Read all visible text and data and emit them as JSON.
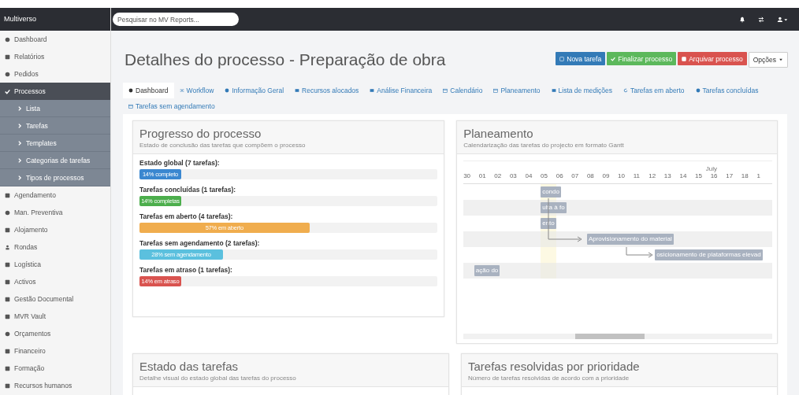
{
  "app": {
    "name": "Multiverso"
  },
  "search": {
    "placeholder": "Pesquisar no MV Reports..."
  },
  "sidebar": {
    "items": [
      {
        "label": "Dashboard",
        "selected": false
      },
      {
        "label": "Relatórios",
        "selected": false
      },
      {
        "label": "Pedidos",
        "selected": false
      },
      {
        "label": "Processos",
        "selected": true,
        "expanded": true,
        "children": [
          {
            "label": "Lista"
          },
          {
            "label": "Tarefas"
          },
          {
            "label": "Templates"
          },
          {
            "label": "Categorias de tarefas"
          },
          {
            "label": "Tipos de processos"
          }
        ]
      },
      {
        "label": "Agendamento",
        "selected": false
      },
      {
        "label": "Man. Preventiva",
        "selected": false
      },
      {
        "label": "Alojamento",
        "selected": false
      },
      {
        "label": "Rondas",
        "selected": false
      },
      {
        "label": "Logística",
        "selected": false
      },
      {
        "label": "Activos",
        "selected": false
      },
      {
        "label": "Gestão Documental",
        "selected": false
      },
      {
        "label": "MVR Vault",
        "selected": false
      },
      {
        "label": "Orçamentos",
        "selected": false
      },
      {
        "label": "Financeiro",
        "selected": false
      },
      {
        "label": "Formação",
        "selected": false
      },
      {
        "label": "Recursos humanos",
        "selected": false
      }
    ]
  },
  "page": {
    "title": "Detalhes do processo - Preparação de obra"
  },
  "actions": [
    {
      "label": "Nova tarefa",
      "kind": "primary"
    },
    {
      "label": "Finalizar processo",
      "kind": "success"
    },
    {
      "label": "Arquivar processo",
      "kind": "danger"
    },
    {
      "label": "Opções",
      "kind": "dropdown"
    }
  ],
  "tabs": [
    {
      "label": "Dashboard",
      "selected": true
    },
    {
      "label": "Workflow",
      "selected": false
    },
    {
      "label": "Informação Geral",
      "selected": false
    },
    {
      "label": "Recursos alocados",
      "selected": false
    },
    {
      "label": "Análise Financeira",
      "selected": false
    },
    {
      "label": "Calendário",
      "selected": false
    },
    {
      "label": "Planeamento",
      "selected": false
    },
    {
      "label": "Lista de medições",
      "selected": false
    },
    {
      "label": "Tarefas em aberto",
      "selected": false
    },
    {
      "label": "Tarefas concluídas",
      "selected": false
    },
    {
      "label": "Tarefas sem agendamento",
      "selected": false
    }
  ],
  "progress": {
    "title": "Progresso do processo",
    "subtitle": "Estado de conclusão das tarefas que compõem o processo",
    "bars": [
      {
        "heading": "Estado global (7 tarefas):",
        "label": "14% completo",
        "level": 0.14,
        "color": "#3a87d0"
      },
      {
        "heading": "Tarefas concluídas (1 tarefas):",
        "label": "14% completas",
        "level": 0.14,
        "color": "#4cae4c"
      },
      {
        "heading": "Tarefas em aberto (4 tarefas):",
        "label": "57% em aberto",
        "level": 0.57,
        "color": "#f0ad4e"
      },
      {
        "heading": "Tarefas sem agendamento (2 tarefas):",
        "label": "28% sem agendamento",
        "level": 0.28,
        "color": "#5bc0de"
      },
      {
        "heading": "Tarefas em atraso (1 tarefas):",
        "label": "14% em atraso",
        "level": 0.14,
        "color": "#d9534f"
      }
    ]
  },
  "planning": {
    "title": "Planeamento",
    "subtitle": "Calendarização das tarefas do projecto em formato Gantt",
    "month": "July",
    "days": [
      "30",
      "01",
      "02",
      "03",
      "04",
      "05",
      "06",
      "07",
      "08",
      "09",
      "10",
      "11",
      "12",
      "13",
      "14",
      "15",
      "16",
      "17",
      "18",
      "1"
    ],
    "tasks": [
      {
        "label": "condo"
      },
      {
        "label": "ulta à fo"
      },
      {
        "label": "ento"
      },
      {
        "label": "Aprovisionamento do material"
      },
      {
        "label": "osicionamento de plataformas elevad"
      },
      {
        "label": "ação do"
      }
    ]
  },
  "lower_cards": [
    {
      "title": "Estado das tarefas",
      "subtitle": "Detalhe visual do estado global das tarefas do processo"
    },
    {
      "title": "Tarefas resolvidas por prioridade",
      "subtitle": "Número de tarefas resolvidas de acordo com a prioridade"
    }
  ]
}
